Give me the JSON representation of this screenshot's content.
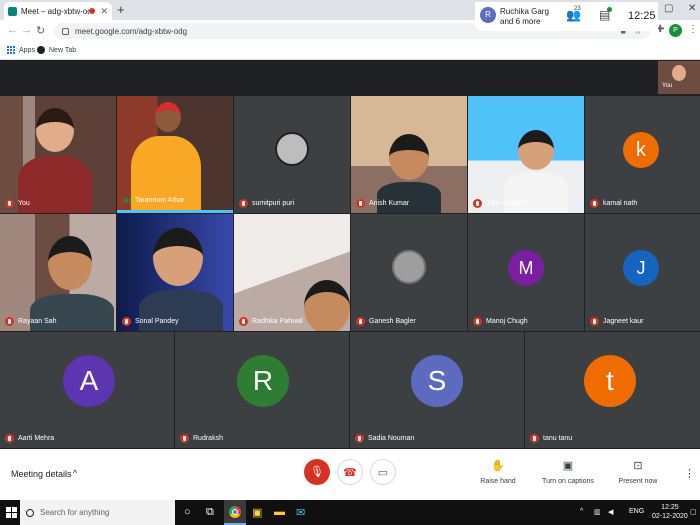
{
  "browser": {
    "tab_title": "Meet – adg-xbtw-odg",
    "tab_close": "✕",
    "new_tab": "+",
    "url": "meet.google.com/adg-xbtw-odg",
    "profile_initial": "P",
    "window_controls": [
      "–",
      "▢",
      "✕"
    ],
    "bookmarks": [
      {
        "label": "Apps",
        "icon": "apps-grid-icon"
      },
      {
        "label": "New Tab",
        "icon": "globe-icon"
      }
    ]
  },
  "meet_header": {
    "presenter_initial": "R",
    "presenter_name": "Ruchika Garg",
    "presenter_more": "and 6 more",
    "people_count": "23",
    "time": "12:25",
    "self_label": "You"
  },
  "tiles": [
    {
      "name": "You",
      "kind": "video"
    },
    {
      "name": "Tarannum Athar",
      "kind": "video",
      "speaking": true
    },
    {
      "name": "sumitpuri puri",
      "kind": "photo"
    },
    {
      "name": "Anish Kumar",
      "kind": "video"
    },
    {
      "name": "Jatin Chawla",
      "kind": "video"
    },
    {
      "name": "kamal nath",
      "kind": "letter",
      "letter": "k",
      "color": "#ef6c00"
    },
    {
      "name": "Rayaan Sah",
      "kind": "video"
    },
    {
      "name": "Sonal Pandey",
      "kind": "video"
    },
    {
      "name": "Radhika Pahwal",
      "kind": "video"
    },
    {
      "name": "Ganesh Bagler",
      "kind": "photo"
    },
    {
      "name": "Manoj Chugh",
      "kind": "letter",
      "letter": "M",
      "color": "#7b1fa2"
    },
    {
      "name": "Jagneet kaur",
      "kind": "letter",
      "letter": "J",
      "color": "#1565c0"
    },
    {
      "name": "Aarti Mehra",
      "kind": "letter",
      "letter": "A",
      "color": "#5e35b1"
    },
    {
      "name": "Rudraksh",
      "kind": "letter",
      "letter": "R",
      "color": "#2e7d32"
    },
    {
      "name": "Sadia Nouman",
      "kind": "letter",
      "letter": "S",
      "color": "#5c6bc0"
    },
    {
      "name": "tanu tanu",
      "kind": "letter",
      "letter": "t",
      "color": "#ef6c00"
    }
  ],
  "controls": {
    "meeting_details": "Meeting details",
    "raise_hand": "Raise hand",
    "captions": "Turn on captions",
    "present_now": "Present now"
  },
  "taskbar": {
    "search_placeholder": "Search for anything",
    "lang": "ENG",
    "time": "12:25",
    "date": "02-12-2020"
  },
  "colors": {
    "meet_bg": "#202124",
    "tile_bg": "#3c4043",
    "danger": "#d93025"
  }
}
